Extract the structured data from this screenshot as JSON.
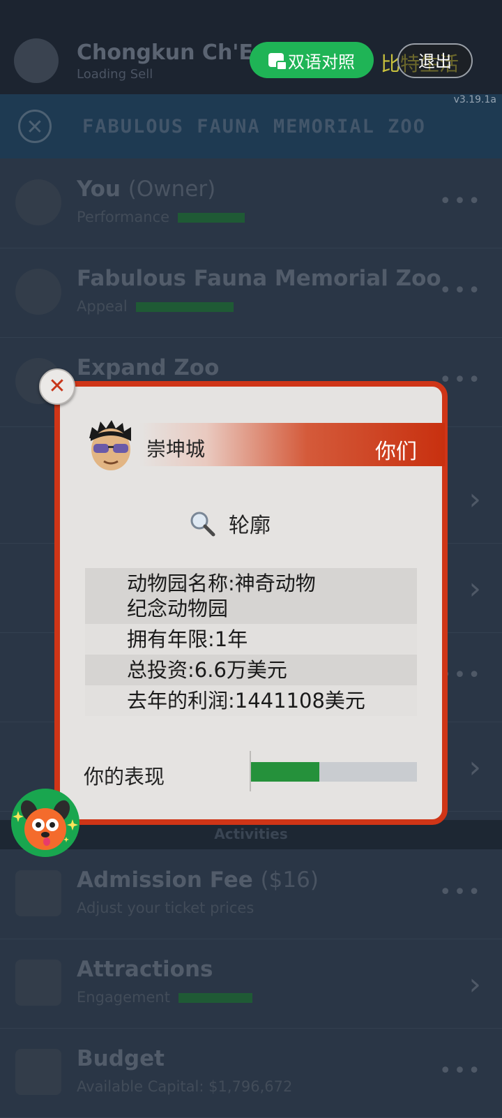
{
  "top_bar": {
    "player_name": "Chongkun Ch'Eng",
    "player_sub": "Loading Sell"
  },
  "version": "v3.19.1a",
  "header_title": "FABULOUS FAUNA MEMORIAL ZOO",
  "overlay": {
    "translate_label": "双语对照",
    "brand_text": "比特生活",
    "exit_label": "退出"
  },
  "background_rows": [
    {
      "title": "You",
      "title_light": "(Owner)",
      "subtitle": "Performance",
      "bar_fraction": 0.35,
      "trail": "dots"
    },
    {
      "title": "Fabulous Fauna Memorial Zoo",
      "title_light": "",
      "subtitle": "Appeal",
      "bar_fraction": 0.5,
      "trail": "dots"
    },
    {
      "title": "Expand Zoo",
      "title_light": "",
      "subtitle": "",
      "bar_fraction": 0,
      "trail": "dots"
    }
  ],
  "section_label": "Activities",
  "background_rows_lower": [
    {
      "title": "Admission Fee",
      "title_light": "($16)",
      "subtitle": "Adjust your ticket prices",
      "trail": "dots"
    },
    {
      "title": "Attractions",
      "title_light": "",
      "subtitle": "Engagement",
      "bar_fraction": 0.4,
      "trail": "chevron"
    },
    {
      "title": "Budget",
      "title_light": "",
      "subtitle": "Available Capital: $1,796,672",
      "trail": "dots"
    }
  ],
  "modal": {
    "player_name": "崇坤城",
    "role": "你们",
    "search_label": "轮廓",
    "info_rows": [
      "动物园名称:神奇动物\n纪念动物园",
      "拥有年限:1年",
      "总投资:6.6万美元",
      "去年的利润:1441108美元"
    ],
    "performance_label": "你的表现",
    "performance_value": 0.41
  },
  "colors": {
    "modal_border": "#cf3517",
    "progress_fill": "#25913b",
    "translate_button": "#1fb456"
  }
}
